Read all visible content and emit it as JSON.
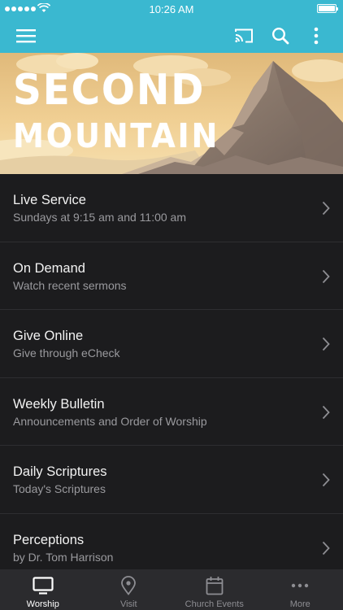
{
  "status_bar": {
    "time": "10:26 AM"
  },
  "toolbar": {
    "menu_icon": "hamburger-icon",
    "cast_icon": "cast-icon",
    "search_icon": "search-icon",
    "more_icon": "vertical-ellipsis-icon"
  },
  "banner": {
    "line1": "SECOND",
    "line2": "MOUNTAIN"
  },
  "menu": {
    "items": [
      {
        "title": "Live Service",
        "subtitle": "Sundays at 9:15 am and 11:00 am"
      },
      {
        "title": "On Demand",
        "subtitle": "Watch recent sermons"
      },
      {
        "title": "Give Online",
        "subtitle": "Give through eCheck"
      },
      {
        "title": "Weekly Bulletin",
        "subtitle": "Announcements and Order of Worship"
      },
      {
        "title": "Daily Scriptures",
        "subtitle": "Today's Scriptures"
      },
      {
        "title": "Perceptions",
        "subtitle": "by Dr. Tom Harrison"
      }
    ]
  },
  "tabbar": {
    "tabs": [
      {
        "label": "Worship",
        "icon": "monitor-icon",
        "active": true
      },
      {
        "label": "Visit",
        "icon": "map-pin-icon",
        "active": false
      },
      {
        "label": "Church Events",
        "icon": "calendar-icon",
        "active": false
      },
      {
        "label": "More",
        "icon": "horizontal-ellipsis-icon",
        "active": false
      }
    ]
  },
  "colors": {
    "accent": "#3ab8d0",
    "background": "#1c1c1e",
    "tabbar": "#2b2b2e",
    "text_primary": "#f2f2f2",
    "text_secondary": "#9a9a9e"
  }
}
